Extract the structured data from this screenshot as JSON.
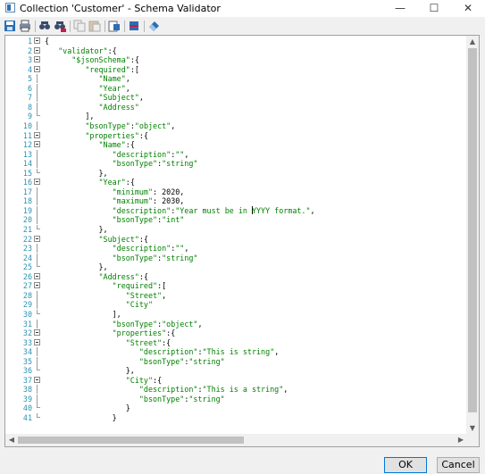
{
  "window": {
    "title": "Collection 'Customer' - Schema Validator",
    "icon": "app-window-icon",
    "controls": {
      "minimize": "—",
      "maximize": "☐",
      "close": "✕"
    }
  },
  "toolbar": {
    "buttons": [
      {
        "name": "save-icon"
      },
      {
        "name": "print-icon"
      },
      {
        "name": "find-icon"
      },
      {
        "name": "find-replace-icon"
      },
      {
        "name": "copy-icon"
      },
      {
        "name": "paste-icon"
      },
      {
        "name": "format-icon"
      },
      {
        "name": "validate-icon"
      },
      {
        "name": "clear-icon"
      }
    ]
  },
  "editor": {
    "lines": [
      {
        "n": "1",
        "fold": "open",
        "text": "{"
      },
      {
        "n": "2",
        "fold": "open",
        "text": "   \"validator\":{"
      },
      {
        "n": "3",
        "fold": "open",
        "text": "      \"$jsonSchema\":{"
      },
      {
        "n": "4",
        "fold": "open",
        "text": "         \"required\":["
      },
      {
        "n": "5",
        "fold": "line",
        "text": "            \"Name\","
      },
      {
        "n": "6",
        "fold": "line",
        "text": "            \"Year\","
      },
      {
        "n": "7",
        "fold": "line",
        "text": "            \"Subject\","
      },
      {
        "n": "8",
        "fold": "line",
        "text": "            \"Address\""
      },
      {
        "n": "9",
        "fold": "end",
        "text": "         ],"
      },
      {
        "n": "10",
        "fold": "line",
        "text": "         \"bsonType\":\"object\","
      },
      {
        "n": "11",
        "fold": "open",
        "text": "         \"properties\":{"
      },
      {
        "n": "12",
        "fold": "open",
        "text": "            \"Name\":{"
      },
      {
        "n": "13",
        "fold": "line",
        "text": "               \"description\":\"\","
      },
      {
        "n": "14",
        "fold": "line",
        "text": "               \"bsonType\":\"string\""
      },
      {
        "n": "15",
        "fold": "end",
        "text": "            },"
      },
      {
        "n": "16",
        "fold": "open",
        "text": "            \"Year\":{"
      },
      {
        "n": "17",
        "fold": "line",
        "text": "               \"minimum\": 2020,"
      },
      {
        "n": "18",
        "fold": "line",
        "text": "               \"maximum\": 2030,"
      },
      {
        "n": "19",
        "fold": "line",
        "text": "               \"description\":\"Year must be in YYYY format.\","
      },
      {
        "n": "20",
        "fold": "line",
        "text": "               \"bsonType\":\"int\""
      },
      {
        "n": "21",
        "fold": "end",
        "text": "            },"
      },
      {
        "n": "22",
        "fold": "open",
        "text": "            \"Subject\":{"
      },
      {
        "n": "23",
        "fold": "line",
        "text": "               \"description\":\"\","
      },
      {
        "n": "24",
        "fold": "line",
        "text": "               \"bsonType\":\"string\""
      },
      {
        "n": "25",
        "fold": "end",
        "text": "            },"
      },
      {
        "n": "26",
        "fold": "open",
        "text": "            \"Address\":{"
      },
      {
        "n": "27",
        "fold": "open",
        "text": "               \"required\":["
      },
      {
        "n": "28",
        "fold": "line",
        "text": "                  \"Street\","
      },
      {
        "n": "29",
        "fold": "line",
        "text": "                  \"City\""
      },
      {
        "n": "30",
        "fold": "end",
        "text": "               ],"
      },
      {
        "n": "31",
        "fold": "line",
        "text": "               \"bsonType\":\"object\","
      },
      {
        "n": "32",
        "fold": "open",
        "text": "               \"properties\":{"
      },
      {
        "n": "33",
        "fold": "open",
        "text": "                  \"Street\":{"
      },
      {
        "n": "34",
        "fold": "line",
        "text": "                     \"description\":\"This is string\","
      },
      {
        "n": "35",
        "fold": "line",
        "text": "                     \"bsonType\":\"string\""
      },
      {
        "n": "36",
        "fold": "end",
        "text": "                  },"
      },
      {
        "n": "37",
        "fold": "open",
        "text": "                  \"City\":{"
      },
      {
        "n": "38",
        "fold": "line",
        "text": "                     \"description\":\"This is a string\","
      },
      {
        "n": "39",
        "fold": "line",
        "text": "                     \"bsonType\":\"string\""
      },
      {
        "n": "40",
        "fold": "end",
        "text": "                  }"
      },
      {
        "n": "41",
        "fold": "end",
        "text": "               }"
      }
    ]
  },
  "scrollbars": {
    "up": "▲",
    "down": "▼",
    "left": "◀",
    "right": "▶"
  },
  "buttons": {
    "ok": "OK",
    "cancel": "Cancel"
  },
  "colors": {
    "string": "#008000",
    "line_number": "#2b91af",
    "primary_border": "#0078d7"
  }
}
